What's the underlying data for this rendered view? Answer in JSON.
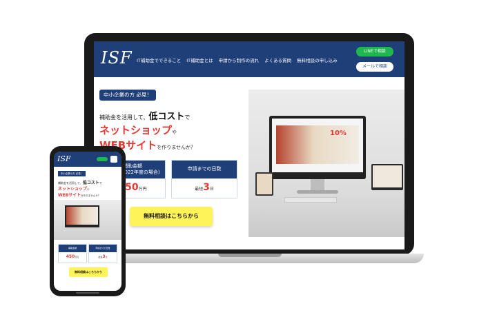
{
  "site": {
    "logo": "ISF",
    "nav": [
      "IT補助金でできること",
      "IT補助金とは",
      "申請から制作の流れ",
      "よくある質問",
      "無料相談の申し込み"
    ],
    "line_button": "LINEで相談",
    "mail_button": "メールで相談"
  },
  "hero": {
    "badge": "中小企業の方 必見！",
    "line1_pre": "補助金を活用して、",
    "line1_emph": "低コスト",
    "line1_post": "で",
    "line2": "ネットショップ",
    "line2_post": "や",
    "line3": "WEBサイト",
    "line3_post": "を作りませんか？"
  },
  "cards": [
    {
      "title": "補助金額",
      "subtitle": "(補助金2022年度の場合)",
      "value": "450",
      "unit": "万円"
    },
    {
      "title": "申請までの日数",
      "subtitle": "",
      "prefix": "最短",
      "value": "3",
      "unit": "日"
    }
  ],
  "cta": "無料相談はこちらから",
  "photo": {
    "monitor_percent": "10%"
  },
  "colors": {
    "header": "#1f3f78",
    "accent": "#e53935",
    "cta": "#fff35a",
    "line": "#1fb850"
  }
}
